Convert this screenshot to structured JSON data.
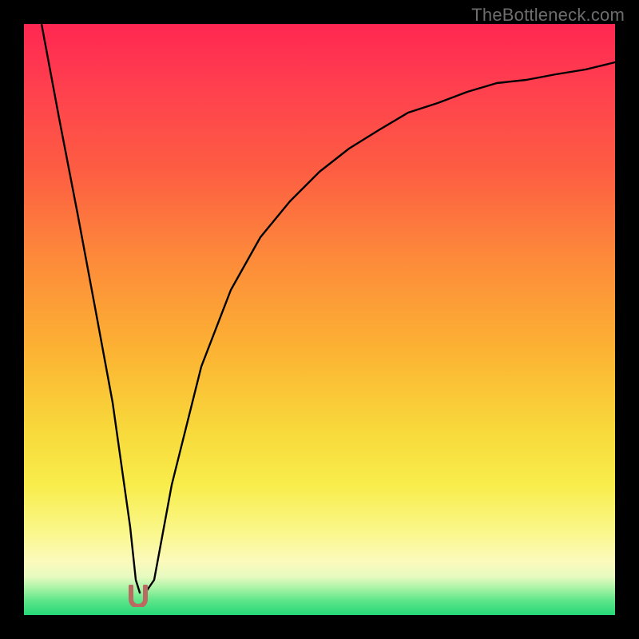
{
  "watermark": "TheBottleneck.com",
  "chart_data": {
    "type": "line",
    "title": "",
    "xlabel": "",
    "ylabel": "",
    "xlim": [
      0,
      100
    ],
    "ylim": [
      0,
      100
    ],
    "grid": false,
    "legend": false,
    "series": [
      {
        "name": "bottleneck-curve",
        "x": [
          3,
          6,
          9,
          12,
          15,
          18,
          19,
          20,
          21,
          22,
          25,
          30,
          35,
          40,
          45,
          50,
          55,
          60,
          65,
          70,
          75,
          80,
          85,
          90,
          95,
          100
        ],
        "values": [
          100,
          84,
          68,
          52,
          36,
          15,
          6,
          4,
          4,
          6,
          22,
          42,
          55,
          64,
          70,
          75,
          79,
          82,
          85,
          87,
          88.5,
          90,
          91,
          92,
          92.8,
          93.5
        ]
      }
    ],
    "annotations": [
      {
        "name": "optimal-marker",
        "x": 20,
        "y": 4,
        "color": "#bb6a62",
        "shape": "u-notch"
      }
    ],
    "background_gradient": {
      "top": "#ff2751",
      "mid": "#f8d73a",
      "bottom": "#25d877"
    }
  }
}
